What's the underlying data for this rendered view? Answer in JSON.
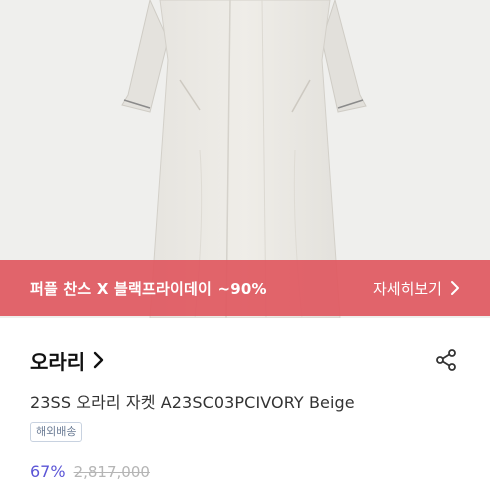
{
  "promo": {
    "text": "퍼플 찬스 X 블랙프라이데이 ~90%",
    "detail_label": "자세히보기",
    "background_color": "#e0585f"
  },
  "brand": {
    "name": "오라리"
  },
  "product": {
    "name": "23SS 오라리 자켓 A23SC03PCIVORY Beige",
    "badge": "해외배송",
    "discount": "67%",
    "original_price": "2,817,000"
  },
  "colors": {
    "discount": "#5b55d6",
    "badge_text": "#6b7c95",
    "image_bg": "#ececea"
  },
  "icons": {
    "promo_chevron": "chevron-right-icon",
    "brand_chevron": "chevron-right-icon",
    "share": "share-icon"
  }
}
